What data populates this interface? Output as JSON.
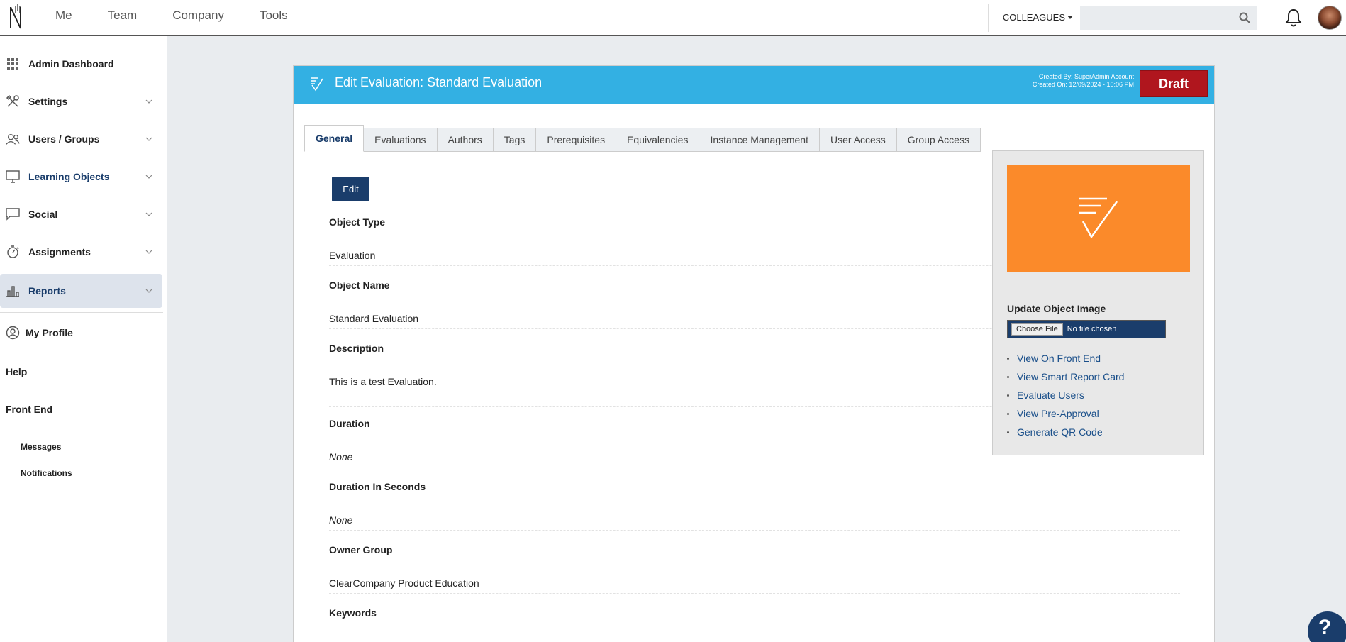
{
  "topnav": {
    "items": [
      "Me",
      "Team",
      "Company",
      "Tools"
    ],
    "colleagues_label": "COLLEAGUES",
    "search_placeholder": ""
  },
  "sidebar": {
    "items": [
      {
        "label": "Admin Dashboard",
        "icon": "grid-icon"
      },
      {
        "label": "Settings",
        "icon": "tools-icon"
      },
      {
        "label": "Users / Groups",
        "icon": "users-icon"
      },
      {
        "label": "Learning Objects",
        "icon": "monitor-icon"
      },
      {
        "label": "Social",
        "icon": "chat-icon"
      },
      {
        "label": "Assignments",
        "icon": "stopwatch-icon"
      },
      {
        "label": "Reports",
        "icon": "bar-chart-icon"
      }
    ],
    "my_profile": "My Profile",
    "help": "Help",
    "front_end": "Front End",
    "messages": "Messages",
    "notifications": "Notifications"
  },
  "card": {
    "title": "Edit Evaluation: Standard Evaluation",
    "created_by": "Created By: SuperAdmin Account",
    "created_on": "Created On: 12/09/2024 - 10:06 PM",
    "status": "Draft",
    "status_color": "#b0161e",
    "header_color": "#33b0e3"
  },
  "tabs": [
    "General",
    "Evaluations",
    "Authors",
    "Tags",
    "Prerequisites",
    "Equivalencies",
    "Instance Management",
    "User Access",
    "Group Access"
  ],
  "edit_label": "Edit",
  "fields": [
    {
      "label": "Object Type",
      "value": "Evaluation"
    },
    {
      "label": "Object Name",
      "value": "Standard Evaluation"
    },
    {
      "label": "Description",
      "value": "This is a test Evaluation."
    },
    {
      "label": "Duration",
      "value": "None"
    },
    {
      "label": "Duration In Seconds",
      "value": "None"
    },
    {
      "label": "Owner Group",
      "value": "ClearCompany Product Education"
    },
    {
      "label": "Keywords",
      "value": ""
    }
  ],
  "right_panel": {
    "image_color": "#fb8a2a",
    "update_title": "Update Object Image",
    "choose_file": "Choose File",
    "no_file": "No file chosen",
    "links": [
      "View On Front End",
      "View Smart Report Card",
      "Evaluate Users",
      "View Pre-Approval",
      "Generate QR Code"
    ]
  },
  "help_button": "?"
}
